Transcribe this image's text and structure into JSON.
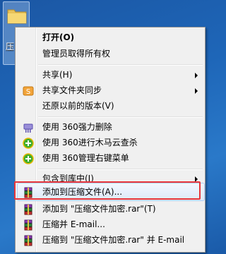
{
  "desktop": {
    "icon_label": "压"
  },
  "menu": {
    "items": [
      {
        "label": "打开(O)",
        "bold": true
      },
      {
        "label": "管理员取得所有权"
      },
      {
        "label": "共享(H)"
      },
      {
        "label": "共享文件夹同步"
      },
      {
        "label": "还原以前的版本(V)"
      },
      {
        "label": "使用 360强力删除"
      },
      {
        "label": "使用 360进行木马云查杀"
      },
      {
        "label": "使用 360管理右键菜单"
      },
      {
        "label": "包含到库中(I)"
      },
      {
        "label": "添加到压缩文件(A)..."
      },
      {
        "label": "添加到 \"压缩文件加密.rar\"(T)"
      },
      {
        "label": "压缩并 E-mail..."
      },
      {
        "label": "压缩到 \"压缩文件加密.rar\" 并 E-mail"
      }
    ]
  },
  "colors": {
    "menu_bg": "#f0f0f0",
    "highlight_border": "#e8363b",
    "desktop_bg": "#1e66b8"
  }
}
